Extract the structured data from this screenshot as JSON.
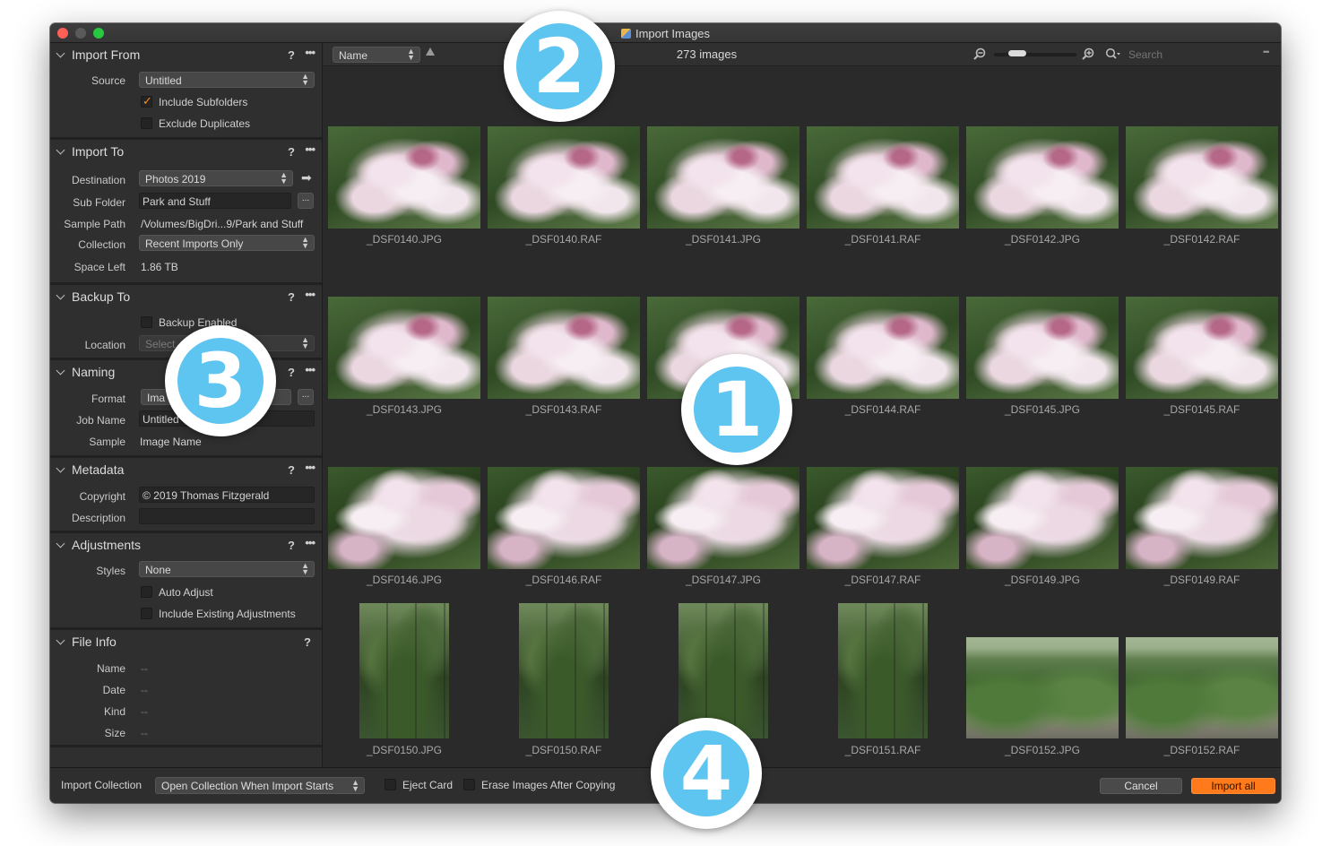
{
  "window": {
    "title": "Import Images"
  },
  "left_panel": {
    "import_from": {
      "title": "Import From",
      "help": "?",
      "more": "•••",
      "source_label": "Source",
      "source_value": "Untitled",
      "include_subfolders": "Include Subfolders",
      "include_subfolders_checked": true,
      "exclude_duplicates": "Exclude Duplicates",
      "exclude_duplicates_checked": false
    },
    "import_to": {
      "title": "Import To",
      "help": "?",
      "more": "•••",
      "destination_label": "Destination",
      "destination_value": "Photos 2019",
      "subfolder_label": "Sub Folder",
      "subfolder_value": "Park and Stuff",
      "sample_path_label": "Sample Path",
      "sample_path_value": "/Volumes/BigDri...9/Park and Stuff",
      "collection_label": "Collection",
      "collection_value": "Recent Imports Only",
      "space_left_label": "Space Left",
      "space_left_value": "1.86 TB",
      "browse": "..."
    },
    "backup_to": {
      "title": "Backup To",
      "help": "?",
      "more": "•••",
      "backup_enabled": "Backup Enabled",
      "backup_enabled_checked": false,
      "location_label": "Location",
      "location_value": "Select"
    },
    "naming": {
      "title": "Naming",
      "help": "?",
      "more": "•••",
      "format_label": "Format",
      "format_value": "Ima",
      "job_name_label": "Job Name",
      "job_name_value": "Untitled",
      "sample_label": "Sample",
      "sample_value": "Image Name",
      "browse": "..."
    },
    "metadata": {
      "title": "Metadata",
      "help": "?",
      "more": "•••",
      "copyright_label": "Copyright",
      "copyright_value": "© 2019 Thomas Fitzgerald",
      "description_label": "Description",
      "description_value": ""
    },
    "adjustments": {
      "title": "Adjustments",
      "help": "?",
      "more": "•••",
      "styles_label": "Styles",
      "styles_value": "None",
      "auto_adjust": "Auto Adjust",
      "auto_adjust_checked": false,
      "include_existing": "Include Existing Adjustments",
      "include_existing_checked": false
    },
    "file_info": {
      "title": "File Info",
      "help": "?",
      "name_label": "Name",
      "name_value": "--",
      "date_label": "Date",
      "date_value": "--",
      "kind_label": "Kind",
      "kind_value": "--",
      "size_label": "Size",
      "size_value": "--"
    }
  },
  "toolbar": {
    "sort_value": "Name",
    "image_count": "273 images",
    "search_placeholder": "Search",
    "zoom_out_icon": "zoom-out-icon",
    "zoom_in_icon": "zoom-in-icon"
  },
  "thumbnails": [
    {
      "name": "_DSF0140.JPG",
      "kind": "flower",
      "shape": "land"
    },
    {
      "name": "_DSF0140.RAF",
      "kind": "flower",
      "shape": "land"
    },
    {
      "name": "_DSF0141.JPG",
      "kind": "flower",
      "shape": "land"
    },
    {
      "name": "_DSF0141.RAF",
      "kind": "flower",
      "shape": "land"
    },
    {
      "name": "_DSF0142.JPG",
      "kind": "flower",
      "shape": "land"
    },
    {
      "name": "_DSF0142.RAF",
      "kind": "flower",
      "shape": "land"
    },
    {
      "name": "_DSF0143.JPG",
      "kind": "flower",
      "shape": "land"
    },
    {
      "name": "_DSF0143.RAF",
      "kind": "flower",
      "shape": "land"
    },
    {
      "name": "",
      "kind": "flower",
      "shape": "land"
    },
    {
      "name": "_DSF0144.RAF",
      "kind": "flower",
      "shape": "land"
    },
    {
      "name": "_DSF0145.JPG",
      "kind": "flower",
      "shape": "land"
    },
    {
      "name": "_DSF0145.RAF",
      "kind": "flower",
      "shape": "land"
    },
    {
      "name": "_DSF0146.JPG",
      "kind": "flower2",
      "shape": "land"
    },
    {
      "name": "_DSF0146.RAF",
      "kind": "flower2",
      "shape": "land"
    },
    {
      "name": "_DSF0147.JPG",
      "kind": "flower2",
      "shape": "land"
    },
    {
      "name": "_DSF0147.RAF",
      "kind": "flower2",
      "shape": "land"
    },
    {
      "name": "_DSF0149.JPG",
      "kind": "flower2",
      "shape": "land"
    },
    {
      "name": "_DSF0149.RAF",
      "kind": "flower2",
      "shape": "land"
    },
    {
      "name": "_DSF0150.JPG",
      "kind": "trellis",
      "shape": "port"
    },
    {
      "name": "_DSF0150.RAF",
      "kind": "trellis",
      "shape": "port"
    },
    {
      "name": ".JPG",
      "kind": "trellis",
      "shape": "port"
    },
    {
      "name": "_DSF0151.RAF",
      "kind": "trellis",
      "shape": "port"
    },
    {
      "name": "_DSF0152.JPG",
      "kind": "garden",
      "shape": "wide"
    },
    {
      "name": "_DSF0152.RAF",
      "kind": "garden",
      "shape": "wide"
    }
  ],
  "bottom_bar": {
    "import_collection_label": "Import Collection",
    "import_collection_value": "Open Collection When Import Starts",
    "eject_card": "Eject Card",
    "erase_images": "Erase Images After Copying",
    "cancel": "Cancel",
    "import_all": "Import all"
  },
  "callouts": [
    "1",
    "2",
    "3",
    "4"
  ],
  "colors": {
    "accent": "#ff7a1a",
    "callout": "#5ec4f0",
    "check": "#ff8a1e"
  }
}
